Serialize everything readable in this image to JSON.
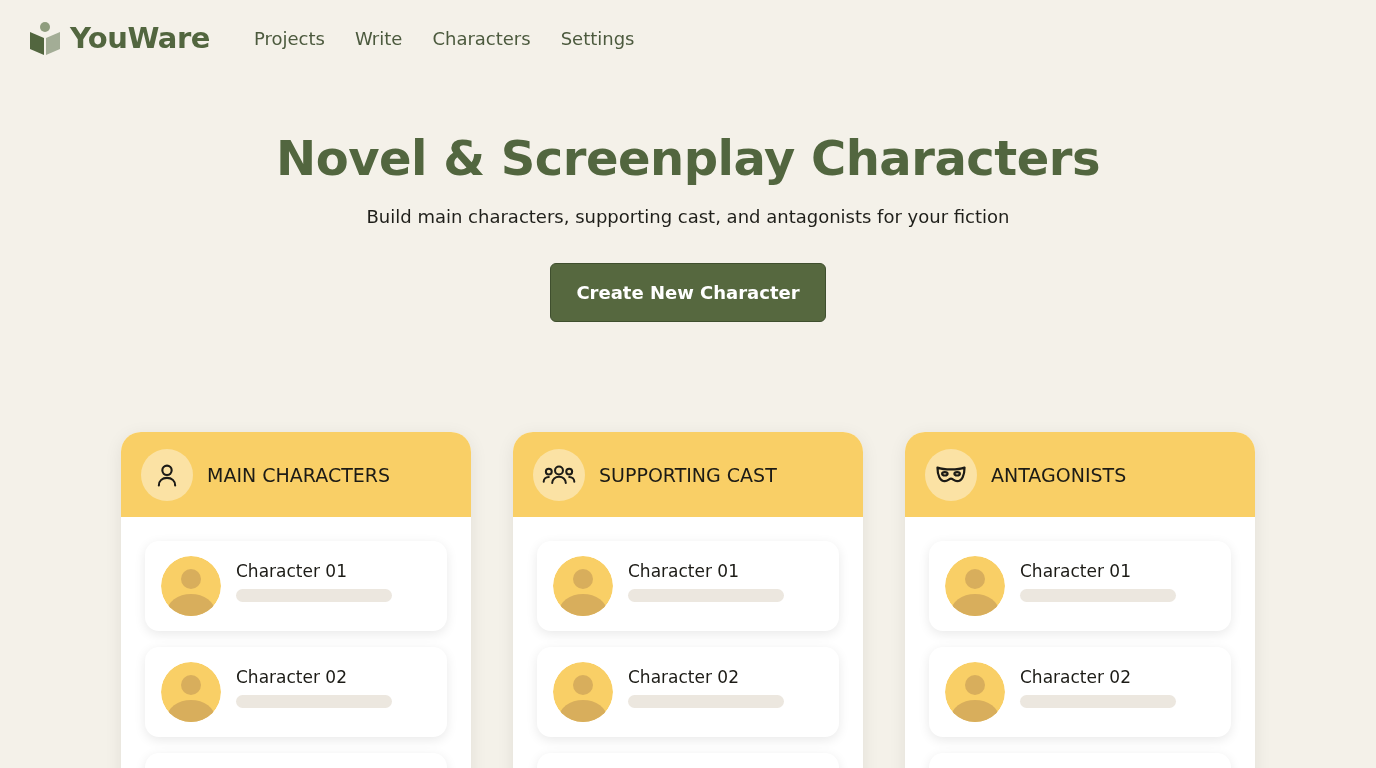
{
  "brand": {
    "name": "YouWare"
  },
  "nav": [
    "Projects",
    "Write",
    "Characters",
    "Settings"
  ],
  "hero": {
    "title": "Novel & Screenplay Characters",
    "subtitle": "Build main characters, supporting cast, and antagonists for your fiction",
    "button": "Create New Character"
  },
  "columns": [
    {
      "kind": "person",
      "title": "MAIN CHARACTERS",
      "characters": [
        "Character 01",
        "Character 02"
      ]
    },
    {
      "kind": "group",
      "title": "SUPPORTING CAST",
      "characters": [
        "Character 01",
        "Character 02"
      ]
    },
    {
      "kind": "mask",
      "title": "ANTAGONISTS",
      "characters": [
        "Character 01",
        "Character 02"
      ]
    }
  ]
}
